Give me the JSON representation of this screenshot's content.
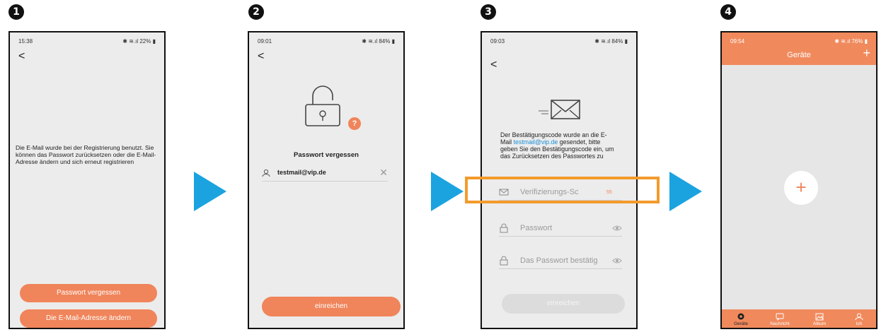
{
  "steps": [
    "1",
    "2",
    "3",
    "4"
  ],
  "colors": {
    "accent": "#f0845a",
    "arrow": "#1ba3e0",
    "highlight": "#f39a2c"
  },
  "screen1": {
    "time": "15:38",
    "battery": "22%",
    "message": "Die E-Mail wurde bei der Registrierung benutzt. Sie können das Passwort zurücksetzen oder die E-Mail-Adresse ändern und sich erneut registrieren",
    "btn_forgot": "Passwort vergessen",
    "btn_change_email": "Die E-Mail-Adresse ändern"
  },
  "screen2": {
    "time": "09:01",
    "battery": "84%",
    "title": "Passwort vergessen",
    "email": "testmail@vip.de",
    "submit": "einreichen"
  },
  "screen3": {
    "time": "09:03",
    "battery": "84%",
    "text_part1": "Der Bestätigungscode wurde an die E-Mail ",
    "email": "testmail@vip.de",
    "text_part2": " gesendet, bitte geben Sie den Bestätigungscode ein, um das Zurücksetzen des Passwortes zu",
    "code_placeholder": "Verifizierungs-Sc",
    "countdown": "55",
    "password_placeholder": "Passwort",
    "confirm_placeholder": "Das Passwort bestätig",
    "submit": "einreichen"
  },
  "screen4": {
    "time": "09:54",
    "battery": "76%",
    "title": "Geräte",
    "tabs": [
      "Geräte",
      "Nachricht",
      "Album",
      "Ich"
    ]
  }
}
